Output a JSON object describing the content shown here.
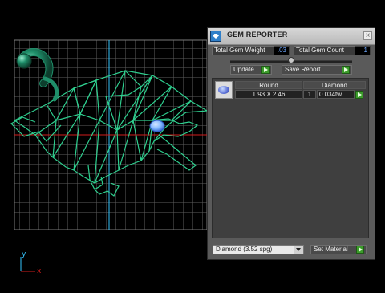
{
  "panel": {
    "title": "GEM REPORTER",
    "total_gem_weight_label": "Total Gem Weight",
    "total_gem_weight_value": ".03",
    "total_gem_count_label": "Total Gem Count",
    "total_gem_count_value": "1",
    "update_label": "Update",
    "save_report_label": "Save Report",
    "table": {
      "headers": [
        "Round",
        "Diamond"
      ],
      "rows": [
        {
          "size": "1.93 X 2.46",
          "count": "1",
          "weight": "0.034tw"
        }
      ]
    },
    "material_select": "Diamond    (3.52 spg)",
    "set_material_label": "Set Material"
  },
  "viewport": {
    "axis_y": "y",
    "axis_x": "x",
    "colors": {
      "background": "#000000",
      "grid": "#6a6a6a",
      "wireframe": "#2fcf8f",
      "gem": "#7fb6ff",
      "axis_x": "#d21b1b",
      "axis_y": "#35c6ff"
    }
  }
}
